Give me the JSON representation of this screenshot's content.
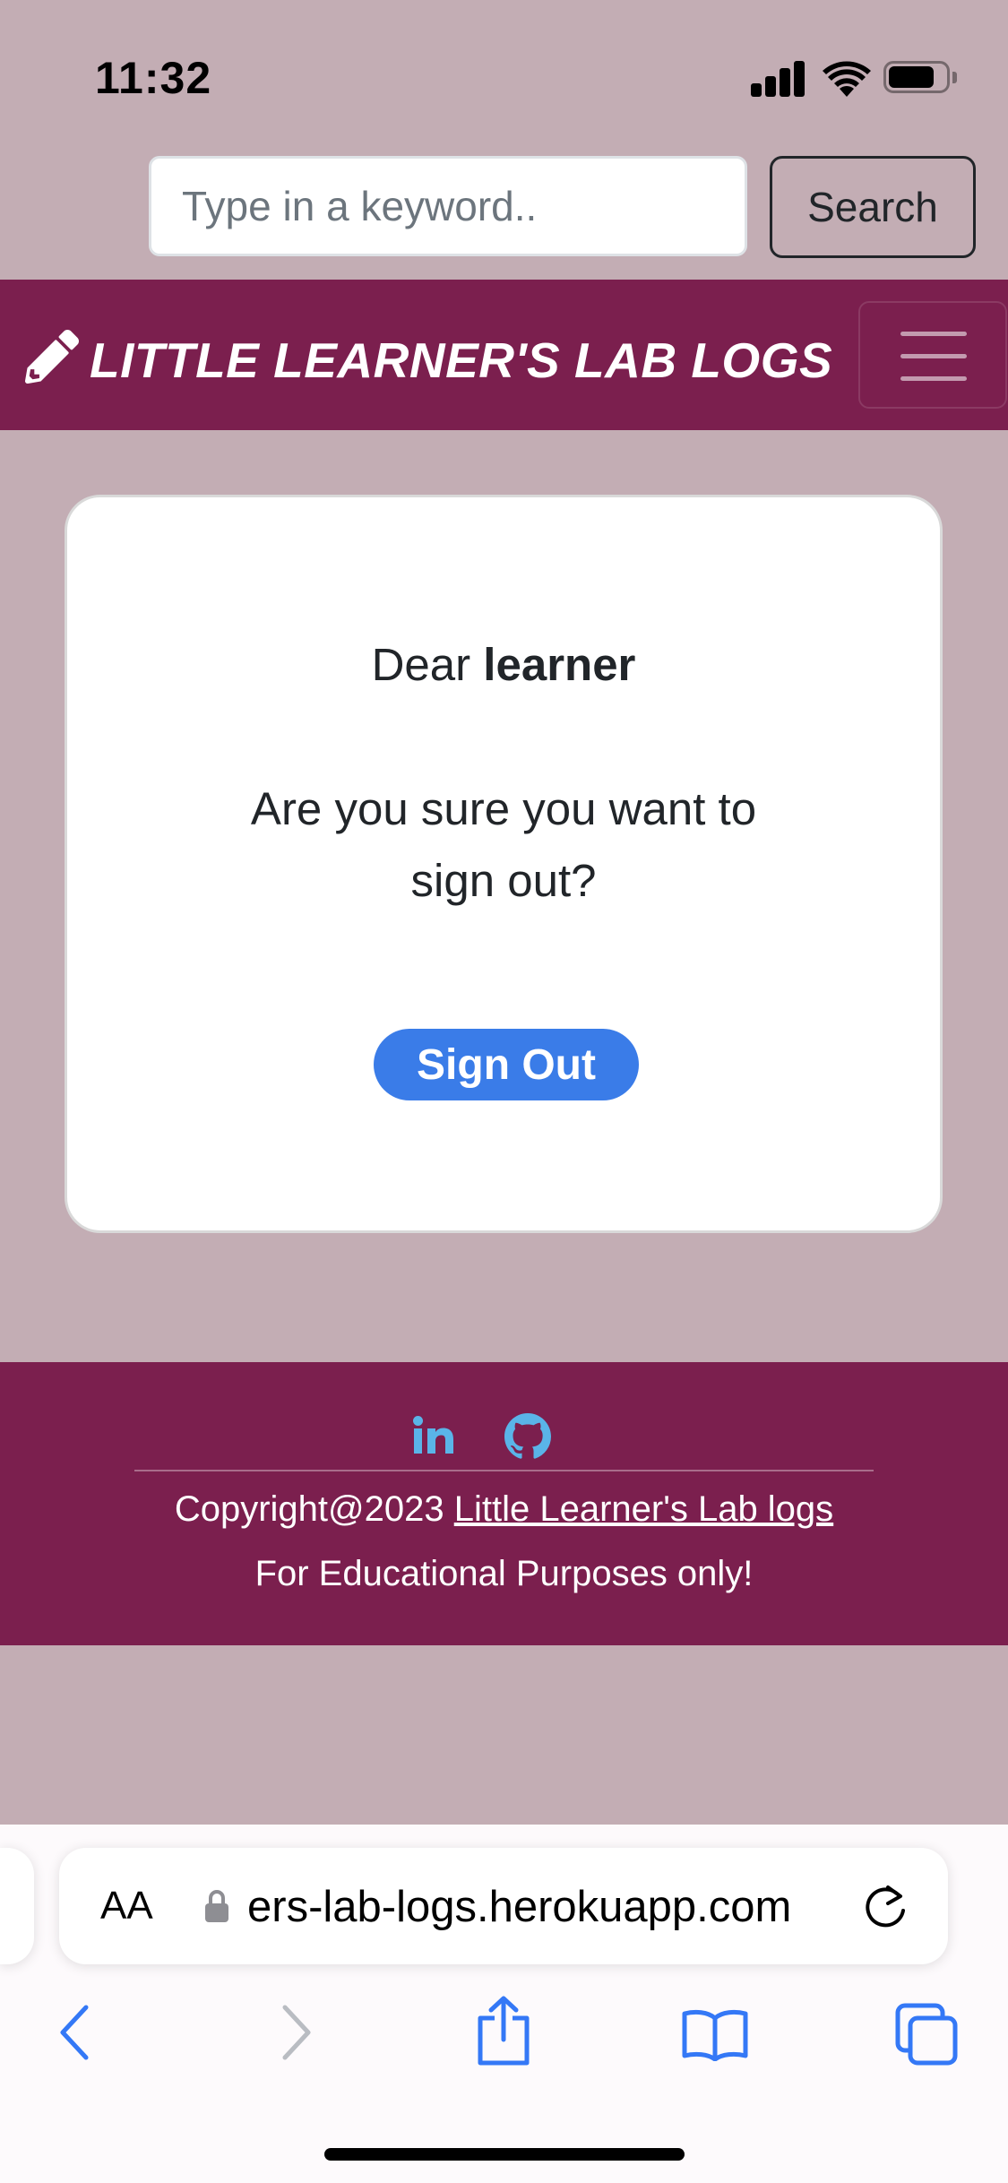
{
  "status_bar": {
    "time": "11:32",
    "battery_level": 0.8
  },
  "search": {
    "placeholder": "Type in a keyword..",
    "value": "",
    "button_label": "Search"
  },
  "navbar": {
    "brand": "LITTLE LEARNER'S LAB LOGS",
    "brand_icon": "pencil-icon",
    "toggler_icon": "hamburger-menu-icon"
  },
  "card": {
    "greeting_prefix": "Dear",
    "username": "learner",
    "question_line1": "Are you sure you want to",
    "question_line2": "sign out?",
    "signout_label": "Sign Out"
  },
  "footer": {
    "social_icons": [
      "linkedin-icon",
      "github-icon"
    ],
    "copyright_prefix": "Copyright@2023",
    "copyright_link": "Little Learner's Lab logs",
    "note": "For Educational Purposes only!"
  },
  "browser": {
    "text_size_label": "AA",
    "url": "ers-lab-logs.herokuapp.com"
  },
  "colors": {
    "page_bg": "#c3adb4",
    "brand_bg": "#7b1f4e",
    "primary_button": "#3a7ce8",
    "social_icon": "#5ab4e8"
  }
}
